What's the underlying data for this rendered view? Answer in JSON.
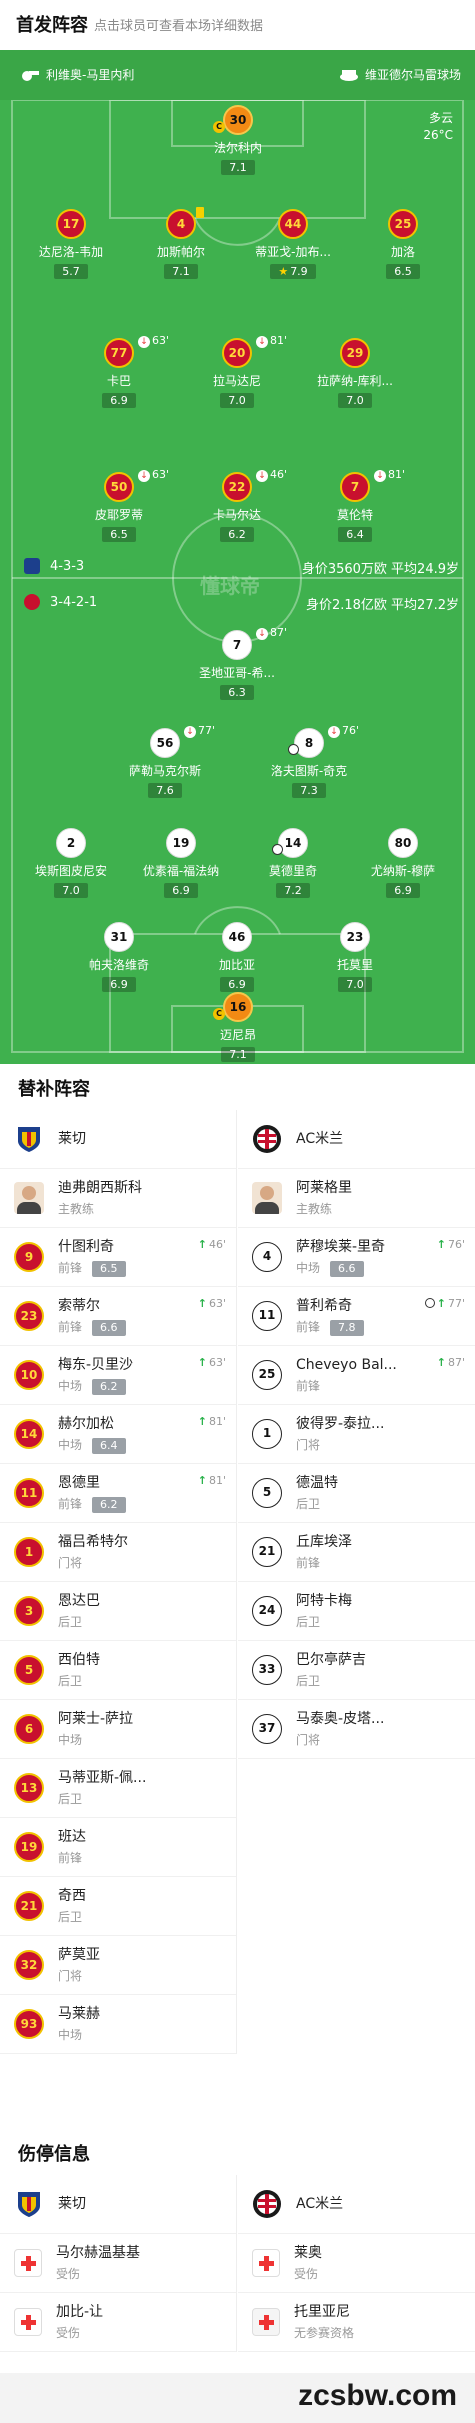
{
  "header": {
    "title": "首发阵容",
    "hint": "点击球员可查看本场详细数据"
  },
  "pitch": {
    "home_name": "利维奥-马里内利",
    "away_name": "维亚德尔马雷球场",
    "weather": "多云",
    "temperature": "26°C",
    "watermark": "懂球帝"
  },
  "lecce_lineup": {
    "formation": "4-3-3",
    "value": "身价3560万欧",
    "avg_age": "平均24.9岁",
    "players": [
      {
        "num": "30",
        "name": "法尔科内",
        "rating": "7.1"
      },
      {
        "num": "17",
        "name": "达尼洛-韦加",
        "rating": "5.7"
      },
      {
        "num": "4",
        "name": "加斯帕尔",
        "rating": "7.1"
      },
      {
        "num": "44",
        "name": "蒂亚戈-加布...",
        "rating": "7.9"
      },
      {
        "num": "25",
        "name": "加洛",
        "rating": "6.5"
      },
      {
        "num": "77",
        "name": "卡巴",
        "rating": "6.9",
        "sub": "63'"
      },
      {
        "num": "20",
        "name": "拉马达尼",
        "rating": "7.0",
        "sub": "81'"
      },
      {
        "num": "29",
        "name": "拉萨纳-库利...",
        "rating": "7.0"
      },
      {
        "num": "50",
        "name": "皮耶罗蒂",
        "rating": "6.5",
        "sub": "63'"
      },
      {
        "num": "22",
        "name": "卡马尔达",
        "rating": "6.2",
        "sub": "46'"
      },
      {
        "num": "7",
        "name": "莫伦特",
        "rating": "6.4",
        "sub": "81'"
      }
    ]
  },
  "milan_lineup": {
    "formation": "3-4-2-1",
    "value": "身价2.18亿欧",
    "avg_age": "平均27.2岁",
    "players": [
      {
        "num": "7",
        "name": "圣地亚哥-希...",
        "rating": "6.3",
        "sub": "87'"
      },
      {
        "num": "56",
        "name": "萨勒马克尔斯",
        "rating": "7.6",
        "sub": "77'"
      },
      {
        "num": "8",
        "name": "洛夫图斯-奇克",
        "rating": "7.3",
        "sub": "76'"
      },
      {
        "num": "2",
        "name": "埃斯图皮尼安",
        "rating": "7.0"
      },
      {
        "num": "19",
        "name": "优素福-福法纳",
        "rating": "6.9"
      },
      {
        "num": "14",
        "name": "莫德里奇",
        "rating": "7.2"
      },
      {
        "num": "80",
        "name": "尤纳斯-穆萨",
        "rating": "6.9"
      },
      {
        "num": "31",
        "name": "帕夫洛维奇",
        "rating": "6.9"
      },
      {
        "num": "46",
        "name": "加比亚",
        "rating": "6.9"
      },
      {
        "num": "23",
        "name": "托莫里",
        "rating": "7.0"
      },
      {
        "num": "16",
        "name": "迈尼昂",
        "rating": "7.1"
      }
    ]
  },
  "subs": {
    "title": "替补阵容",
    "left_team": "莱切",
    "right_team": "AC米兰",
    "left_coach": {
      "name": "迪弗朗西斯科",
      "role": "主教练"
    },
    "right_coach": {
      "name": "阿莱格里",
      "role": "主教练"
    },
    "left": [
      {
        "num": "9",
        "name": "什图利奇",
        "pos": "前锋",
        "rating": "6.5",
        "time": "46'"
      },
      {
        "num": "23",
        "name": "索蒂尔",
        "pos": "前锋",
        "rating": "6.6",
        "time": "63'"
      },
      {
        "num": "10",
        "name": "梅东-贝里沙",
        "pos": "中场",
        "rating": "6.2",
        "time": "63'"
      },
      {
        "num": "14",
        "name": "赫尔加松",
        "pos": "中场",
        "rating": "6.4",
        "time": "81'"
      },
      {
        "num": "11",
        "name": "恩德里",
        "pos": "前锋",
        "rating": "6.2",
        "time": "81'"
      },
      {
        "num": "1",
        "name": "福吕希特尔",
        "pos": "门将"
      },
      {
        "num": "3",
        "name": "恩达巴",
        "pos": "后卫"
      },
      {
        "num": "5",
        "name": "西伯特",
        "pos": "后卫"
      },
      {
        "num": "6",
        "name": "阿莱士-萨拉",
        "pos": "中场"
      },
      {
        "num": "13",
        "name": "马蒂亚斯-佩...",
        "pos": "后卫"
      },
      {
        "num": "19",
        "name": "班达",
        "pos": "前锋"
      },
      {
        "num": "21",
        "name": "奇西",
        "pos": "后卫"
      },
      {
        "num": "32",
        "name": "萨莫亚",
        "pos": "门将"
      },
      {
        "num": "93",
        "name": "马莱赫",
        "pos": "中场"
      }
    ],
    "right": [
      {
        "num": "4",
        "name": "萨穆埃莱-里奇",
        "pos": "中场",
        "rating": "6.6",
        "time": "76'"
      },
      {
        "num": "11",
        "name": "普利希奇",
        "pos": "前锋",
        "rating": "7.8",
        "time": "77'",
        "goal": true
      },
      {
        "num": "25",
        "name": "Cheveyo Bal...",
        "pos": "前锋",
        "time": "87'"
      },
      {
        "num": "1",
        "name": "彼得罗-泰拉...",
        "pos": "门将"
      },
      {
        "num": "5",
        "name": "德温特",
        "pos": "后卫"
      },
      {
        "num": "21",
        "name": "丘库埃泽",
        "pos": "前锋"
      },
      {
        "num": "24",
        "name": "阿特卡梅",
        "pos": "后卫"
      },
      {
        "num": "33",
        "name": "巴尔亭萨吉",
        "pos": "后卫"
      },
      {
        "num": "37",
        "name": "马泰奥-皮塔...",
        "pos": "门将"
      }
    ]
  },
  "injuries": {
    "title": "伤停信息",
    "left_team": "莱切",
    "right_team": "AC米兰",
    "left": [
      {
        "name": "马尔赫温基基",
        "status": "受伤"
      },
      {
        "name": "加比-让",
        "status": "受伤"
      }
    ],
    "right": [
      {
        "name": "莱奥",
        "status": "受伤"
      },
      {
        "name": "托里亚尼",
        "status": "无参赛资格"
      }
    ]
  },
  "footer": {
    "watermark": "zcsbw.com"
  },
  "colors": {
    "pitch": "#3fb14e",
    "lecce_red": "#c8102e",
    "lecce_yellow": "#f2c200",
    "sub_in_green": "#2bb24c"
  }
}
